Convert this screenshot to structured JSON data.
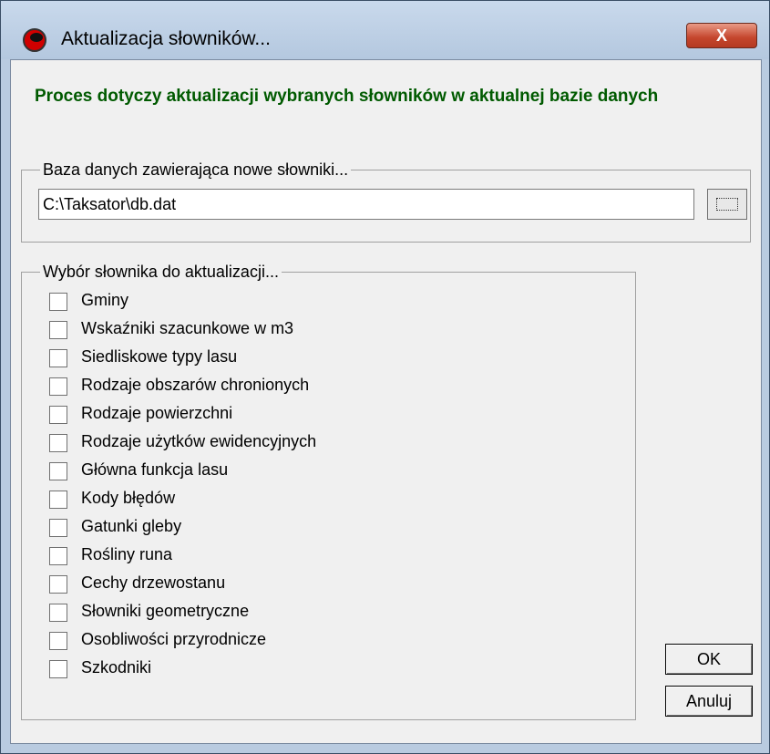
{
  "window": {
    "title": "Aktualizacja słowników...",
    "close_label": "X"
  },
  "heading": "Proces dotyczy aktualizacji wybranych słowników w aktualnej bazie danych",
  "database_group": {
    "legend": "Baza danych zawierająca nowe słowniki...",
    "path_value": "C:\\Taksator\\db.dat"
  },
  "dictionary_group": {
    "legend": "Wybór słownika do aktualizacji...",
    "items": [
      {
        "label": "Gminy",
        "checked": false
      },
      {
        "label": "Wskaźniki szacunkowe w m3",
        "checked": false
      },
      {
        "label": "Siedliskowe typy lasu",
        "checked": false
      },
      {
        "label": "Rodzaje obszarów chronionych",
        "checked": false
      },
      {
        "label": "Rodzaje powierzchni",
        "checked": false
      },
      {
        "label": "Rodzaje użytków ewidencyjnych",
        "checked": false
      },
      {
        "label": "Główna funkcja lasu",
        "checked": false
      },
      {
        "label": "Kody błędów",
        "checked": false
      },
      {
        "label": "Gatunki gleby",
        "checked": false
      },
      {
        "label": "Rośliny runa",
        "checked": false
      },
      {
        "label": "Cechy drzewostanu",
        "checked": false
      },
      {
        "label": "Słowniki geometryczne",
        "checked": false
      },
      {
        "label": "Osobliwości przyrodnicze",
        "checked": false
      },
      {
        "label": "Szkodniki",
        "checked": false
      }
    ]
  },
  "buttons": {
    "ok": "OK",
    "cancel": "Anuluj"
  },
  "colors": {
    "heading": "#005a00",
    "frame": "#b9cbe0",
    "close_button": "#c4452c"
  }
}
